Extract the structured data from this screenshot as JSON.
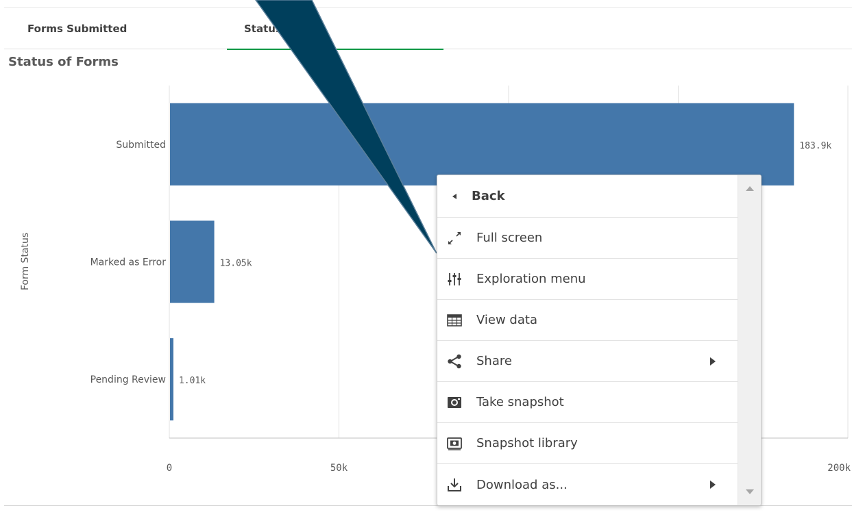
{
  "tabs": [
    {
      "label": "Forms Submitted",
      "active": false
    },
    {
      "label": "Status",
      "active": true
    }
  ],
  "viz": {
    "title": "Status of Forms"
  },
  "colors": {
    "bar": "#4477aa",
    "grid": "#e0e0e0",
    "tab_active": "#009845",
    "pointer": "#003f5c"
  },
  "chart_data": {
    "type": "bar",
    "orientation": "horizontal",
    "categories": [
      "Submitted",
      "Marked as Error",
      "Pending Review"
    ],
    "values": [
      183900,
      13050,
      1010
    ],
    "value_labels": [
      "183.9k",
      "13.05k",
      "1.01k"
    ],
    "ylabel": "Form Status",
    "xlim": [
      0,
      200000
    ],
    "x_ticks": [
      0,
      50000,
      200000
    ],
    "x_tick_labels": [
      "0",
      "50k",
      "200k"
    ],
    "grid": true
  },
  "context_menu": {
    "items": [
      {
        "label": "Back",
        "icon": "back-arrow-icon",
        "submenu": false
      },
      {
        "label": "Full screen",
        "icon": "fullscreen-icon",
        "submenu": false
      },
      {
        "label": "Exploration menu",
        "icon": "exploration-sliders-icon",
        "submenu": false
      },
      {
        "label": "View data",
        "icon": "table-icon",
        "submenu": false
      },
      {
        "label": "Share",
        "icon": "share-icon",
        "submenu": true
      },
      {
        "label": "Take snapshot",
        "icon": "camera-icon",
        "submenu": false
      },
      {
        "label": "Snapshot library",
        "icon": "snapshot-library-icon",
        "submenu": false
      },
      {
        "label": "Download as...",
        "icon": "download-icon",
        "submenu": true
      }
    ]
  }
}
